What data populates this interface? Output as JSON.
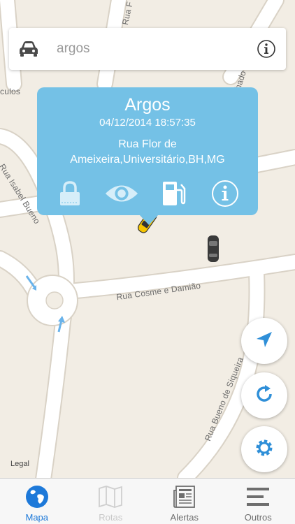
{
  "map": {
    "street_labels": {
      "rua_isabel_bueno": "Rua Isabel Bueno",
      "rua_cosme_damiao": "Rua Cosme e Damião",
      "rua_bueno_siqueira": "Rua Bueno de Siqueira",
      "rua_sargento_levy": "Rua Sargento Levy Machado",
      "rua_top": "Rua F",
      "culos": "culos"
    },
    "legal": "Legal"
  },
  "search": {
    "placeholder": "argos",
    "value": ""
  },
  "popup": {
    "title": "Argos",
    "datetime": "04/12/2014 18:57:35",
    "address": "Rua Flor de Ameixeira,Universitário,BH,MG"
  },
  "tabs": [
    {
      "label": "Mapa",
      "state": "active"
    },
    {
      "label": "Rotas",
      "state": "disabled"
    },
    {
      "label": "Alertas",
      "state": "normal"
    },
    {
      "label": "Outros",
      "state": "normal"
    }
  ],
  "colors": {
    "accent": "#1d79d9",
    "popup": "#74c1e6",
    "fab_icon": "#2f8fd8",
    "map_bg": "#f2ede4",
    "road": "#ffffff"
  }
}
